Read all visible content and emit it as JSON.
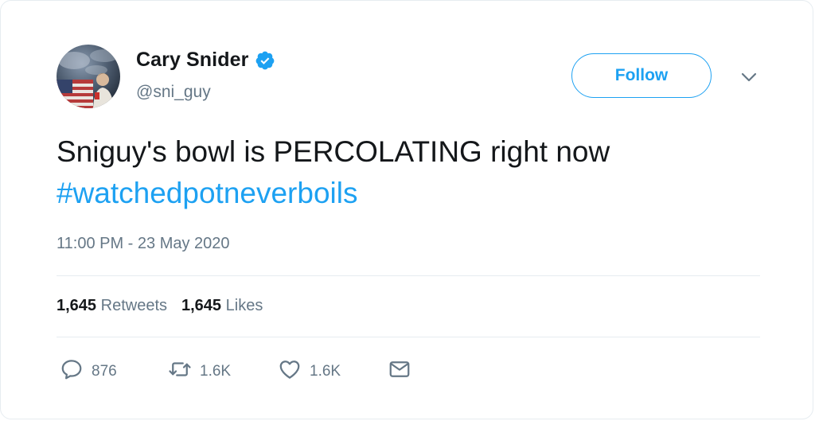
{
  "author": {
    "display_name": "Cary Snider",
    "handle": "@sni_guy",
    "verified": true
  },
  "follow_label": "Follow",
  "tweet": {
    "text": "Sniguy's bowl is PERCOLATING right now ",
    "hashtag": "#watchedpotneverboils"
  },
  "timestamp": "11:00 PM - 23 May 2020",
  "stats": {
    "retweets_count": "1,645",
    "retweets_label": "Retweets",
    "likes_count": "1,645",
    "likes_label": "Likes"
  },
  "actions": {
    "replies": "876",
    "retweets": "1.6K",
    "likes": "1.6K"
  },
  "colors": {
    "accent": "#1da1f2",
    "text": "#14171a",
    "muted": "#657786",
    "border": "#e6ecf0"
  },
  "icons": [
    "verified-badge-icon",
    "chevron-down-icon",
    "reply-icon",
    "retweet-icon",
    "heart-icon",
    "envelope-icon"
  ]
}
